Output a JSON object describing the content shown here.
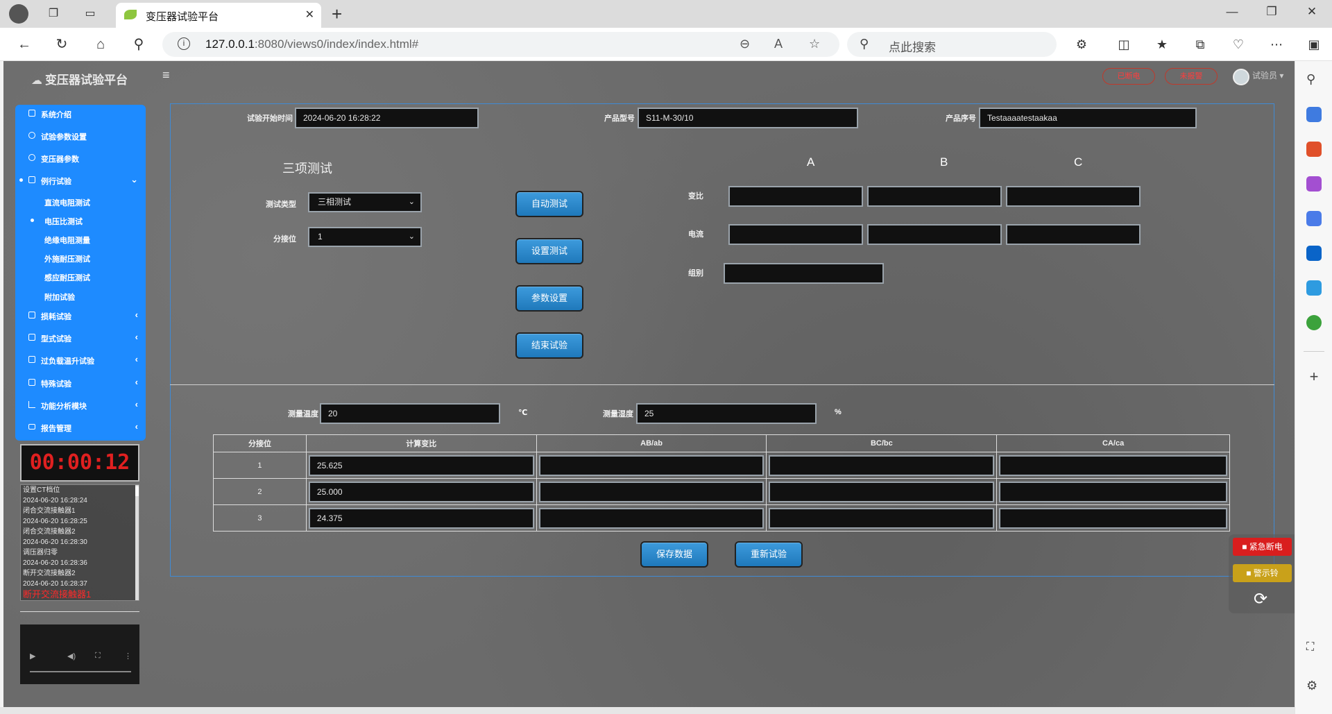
{
  "browser": {
    "tab_title": "变压器试验平台",
    "url_host": "127.0.0.1",
    "url_rest": ":8080/views0/index/index.html#",
    "search_placeholder": "点此搜索"
  },
  "app": {
    "brand": "变压器试验平台",
    "header_btn1": "已断电",
    "header_btn2": "未报警",
    "user": "试验员"
  },
  "menu": {
    "items": [
      {
        "label": "系统介绍"
      },
      {
        "label": "试验参数设置"
      },
      {
        "label": "变压器参数"
      },
      {
        "label": "例行试验"
      },
      {
        "label": "损耗试验"
      },
      {
        "label": "型式试验"
      },
      {
        "label": "过负载温升试验"
      },
      {
        "label": "特殊试验"
      },
      {
        "label": "功能分析模块"
      },
      {
        "label": "报告管理"
      }
    ],
    "sub_items": [
      {
        "label": "直流电阻测试"
      },
      {
        "label": "电压比测试"
      },
      {
        "label": "绝缘电阻测量"
      },
      {
        "label": "外施耐压测试"
      },
      {
        "label": "感应耐压测试"
      },
      {
        "label": "附加试验"
      }
    ]
  },
  "timer": "00:00:12",
  "log": [
    "设置CT档位",
    "2024-06-20 16:28:24",
    "闭合交流接触器1",
    "2024-06-20 16:28:25",
    "闭合交流接触器2",
    "2024-06-20 16:28:30",
    "调压器归零",
    "2024-06-20 16:28:36",
    "断开交流接触器2",
    "2024-06-20 16:28:37",
    "断开交流接触器1"
  ],
  "top_fields": {
    "start_time_label": "试验开始时间",
    "start_time": "2024-06-20 16:28:22",
    "model_label": "产品型号",
    "model": "S11-M-30/10",
    "serial_label": "产品序号",
    "serial": "Testaaaatestaakaa"
  },
  "three_test": {
    "title": "三项测试",
    "type_label": "测试类型",
    "type_value": "三相测试",
    "tap_label": "分接位",
    "tap_value": "1",
    "buttons": [
      "自动测试",
      "设置测试",
      "参数设置",
      "结束试验"
    ],
    "phase_headers": [
      "A",
      "B",
      "C"
    ],
    "row_labels": [
      "变比",
      "电流",
      "组别"
    ]
  },
  "env": {
    "temp_label": "测量温度",
    "temp": "20",
    "temp_unit": "℃",
    "humidity_label": "测量湿度",
    "humidity": "25",
    "humidity_unit": "%"
  },
  "table": {
    "headers": [
      "分接位",
      "计算变比",
      "AB/ab",
      "BC/bc",
      "CA/ca"
    ],
    "rows": [
      {
        "tap": "1",
        "ratio": "25.625"
      },
      {
        "tap": "2",
        "ratio": "25.000"
      },
      {
        "tap": "3",
        "ratio": "24.375"
      }
    ]
  },
  "bottom_buttons": {
    "save": "保存数据",
    "retest": "重新试验"
  },
  "float": {
    "emergency": "紧急断电",
    "alarm": "警示铃"
  }
}
